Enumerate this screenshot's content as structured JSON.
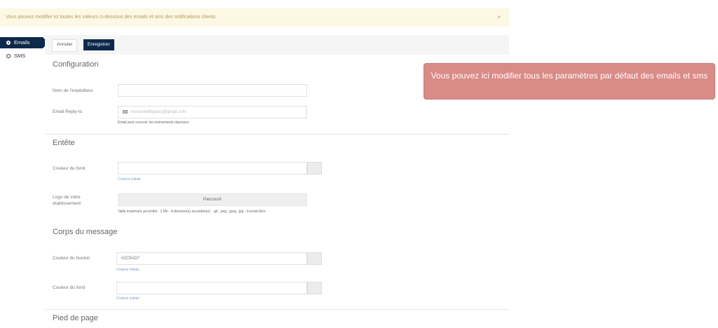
{
  "notice": {
    "text": "Vous pouvez modifier ici toutes les valeurs ci-dessous des emails et sms des notifications clients.",
    "close": "×"
  },
  "sidebar": {
    "items": [
      {
        "label": "Emails",
        "active": true
      },
      {
        "label": "SMS",
        "active": false
      }
    ]
  },
  "toolbar": {
    "cancel_label": "Annuler",
    "save_label": "Enregistrer"
  },
  "configuration": {
    "title": "Configuration",
    "sender_label": "Nom de l'expéditeur",
    "sender_value": "",
    "reply_label": "Email Reply-to",
    "reply_placeholder": "restaurantbypass@gmail.com",
    "reply_help": "Email pour recevoir les événements réponses"
  },
  "header_section": {
    "title": "Entête",
    "bg_label": "Couleur du fond",
    "bg_value": "",
    "bg_help": "Couleur initiale",
    "logo_label": "Logo de votre établissement",
    "browse_label": "Parcourir",
    "logo_help": "Taille maximum accordée : 2 Mo - Extension(s) accordée(s) : .gif, .png, .jpeg, .jpg - Format libre"
  },
  "body_section": {
    "title": "Corps du message",
    "button_color_label": "Couleur du bouton",
    "button_color_value": "#2C9AD7",
    "button_color_help": "Couleur initiale",
    "bg_label": "Couleur du fond",
    "bg_value": "",
    "bg_help": "Couleur initiale"
  },
  "footer_section": {
    "title": "Pied de page"
  },
  "tooltip": {
    "text": "Vous pouvez ici modifier tous les paramètres par défaut des emails et sms"
  },
  "colors": {
    "navy": "#0e2a4a",
    "notice_bg": "#fcf8e3",
    "tooltip_bg": "#d98b86"
  }
}
